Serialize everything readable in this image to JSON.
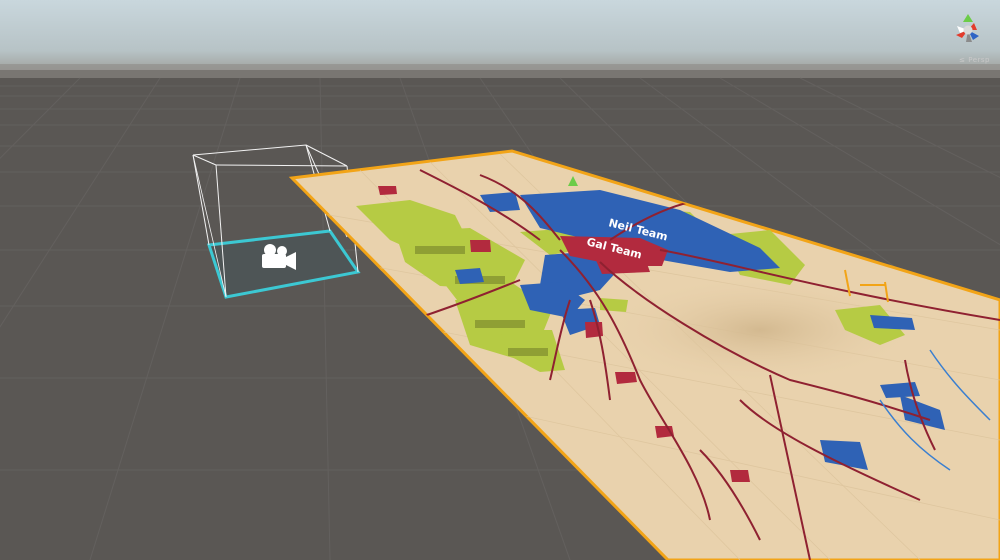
{
  "scene": {
    "labels": {
      "blue_team": "Neil Team",
      "red_team": "Gal Team"
    },
    "colors": {
      "sky_top": "#c7d6dd",
      "horizon": "#9b9894",
      "ground": "#5a5754",
      "grid_line": "#646160",
      "map_base": "#e9d2ad",
      "map_border": "#f2a417",
      "blue_zone": "#2f62b5",
      "red_zone": "#b22a3e",
      "road": "#8f2131",
      "green_zone": "#b6cb44",
      "camera_box": "#e8e8e8",
      "camera_base": "#38c8d4"
    }
  },
  "gizmo": {
    "label": "≤ Persp",
    "icon": "scene-orientation-gizmo-icon"
  },
  "camera": {
    "icon": "camera-icon"
  }
}
